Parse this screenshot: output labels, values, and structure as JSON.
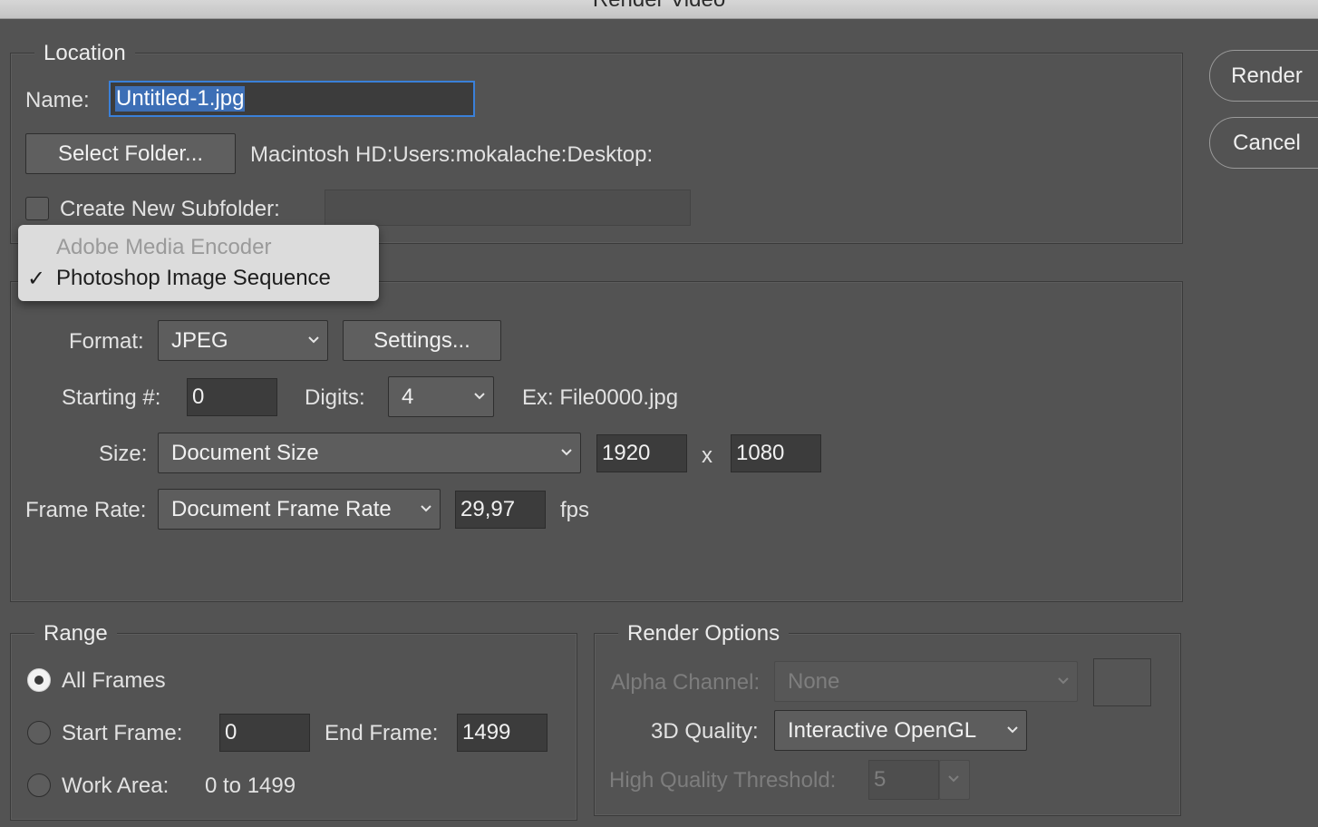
{
  "window": {
    "title": "Render Video"
  },
  "actions": {
    "render_label": "Render",
    "cancel_label": "Cancel"
  },
  "location": {
    "legend": "Location",
    "name_label": "Name:",
    "name_value": "Untitled-1.jpg",
    "select_folder_label": "Select Folder...",
    "folder_path": "Macintosh HD:Users:mokalache:Desktop:",
    "subfolder_label": "Create New Subfolder:",
    "subfolder_checked": false,
    "subfolder_value": ""
  },
  "encoder_menu": {
    "items": [
      {
        "label": "Adobe Media Encoder",
        "enabled": false,
        "checked": false
      },
      {
        "label": "Photoshop Image Sequence",
        "enabled": true,
        "checked": true
      }
    ],
    "checkmark": "✓"
  },
  "sequence": {
    "format_label": "Format:",
    "format_value": "JPEG",
    "settings_label": "Settings...",
    "starting_label": "Starting #:",
    "starting_value": "0",
    "digits_label": "Digits:",
    "digits_value": "4",
    "example_text": "Ex: File0000.jpg",
    "size_label": "Size:",
    "size_value": "Document Size",
    "width_value": "1920",
    "times_label": "x",
    "height_value": "1080",
    "frame_rate_label": "Frame Rate:",
    "frame_rate_value": "Document Frame Rate",
    "fps_value": "29,97",
    "fps_label": "fps"
  },
  "range": {
    "legend": "Range",
    "all_frames_label": "All Frames",
    "selected": "all_frames",
    "start_frame_label": "Start Frame:",
    "start_frame_value": "0",
    "end_frame_label": "End Frame:",
    "end_frame_value": "1499",
    "work_area_label": "Work Area:",
    "work_area_value": "0 to 1499"
  },
  "render_options": {
    "legend": "Render Options",
    "alpha_label": "Alpha Channel:",
    "alpha_value": "None",
    "quality_label": "3D Quality:",
    "quality_value": "Interactive OpenGL",
    "threshold_label": "High Quality Threshold:",
    "threshold_value": "5"
  },
  "colors": {
    "dialog_bg": "#535353",
    "field_bg": "#3c3c3c",
    "selection_highlight": "#3d6fb6",
    "focus_ring": "#3a80d9",
    "menu_bg": "#dcdcdc"
  }
}
